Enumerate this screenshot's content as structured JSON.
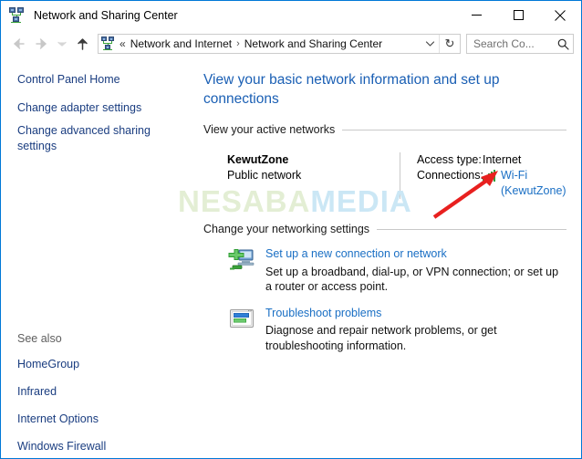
{
  "window": {
    "title": "Network and Sharing Center",
    "icon": "network-sharing-icon",
    "controls": {
      "minimize": "Minimize",
      "maximize": "Maximize",
      "close": "Close"
    }
  },
  "navbar": {
    "back": "Back",
    "forward": "Forward",
    "recent": "Recent locations",
    "up": "Up",
    "address_icon": "network-sharing-icon",
    "overflow_chevrons": "«",
    "breadcrumbs": [
      "Network and Internet",
      "Network and Sharing Center"
    ],
    "separator": "›",
    "dropdown_icon": "chevron-down-icon",
    "refresh_icon": "refresh-icon",
    "refresh_glyph": "↻",
    "search": {
      "placeholder": "Search Co...",
      "value": "Search Co...",
      "icon": "search-icon"
    }
  },
  "sidebar": {
    "links": [
      {
        "label": "Control Panel Home"
      },
      {
        "label": "Change adapter settings"
      },
      {
        "label": "Change advanced sharing settings"
      }
    ],
    "see_also": {
      "title": "See also",
      "links": [
        {
          "label": "HomeGroup"
        },
        {
          "label": "Infrared"
        },
        {
          "label": "Internet Options"
        },
        {
          "label": "Windows Firewall"
        }
      ]
    }
  },
  "main": {
    "heading": "View your basic network information and set up connections",
    "active_networks": {
      "section_title": "View your active networks",
      "network_name": "KewutZone",
      "network_type": "Public network",
      "access_type_label": "Access type:",
      "access_type_value": "Internet",
      "connections_label": "Connections:",
      "connection_name": "Wi-Fi",
      "connection_ssid": "(KewutZone)",
      "signal_icon": "wifi-signal-icon"
    },
    "change_settings": {
      "section_title": "Change your networking settings",
      "tasks": [
        {
          "icon": "new-connection-icon",
          "title": "Set up a new connection or network",
          "description": "Set up a broadband, dial-up, or VPN connection; or set up a router or access point."
        },
        {
          "icon": "troubleshoot-icon",
          "title": "Troubleshoot problems",
          "description": "Diagnose and repair network problems, or get troubleshooting information."
        }
      ]
    }
  },
  "overlays": {
    "watermark": {
      "part1": "NESABA",
      "part2": "MEDIA",
      "color1": "#e3eed4",
      "color2": "#cbe7f5"
    },
    "annotation_arrow": {
      "name": "red-arrow-annotation",
      "color": "#e8201f"
    }
  },
  "colors": {
    "window_border": "#0078d7",
    "heading_blue": "#1a5fb4",
    "link_blue": "#1a6fc4",
    "sidebar_link": "#1a3d80",
    "rule_gray": "#c9c9c9"
  }
}
